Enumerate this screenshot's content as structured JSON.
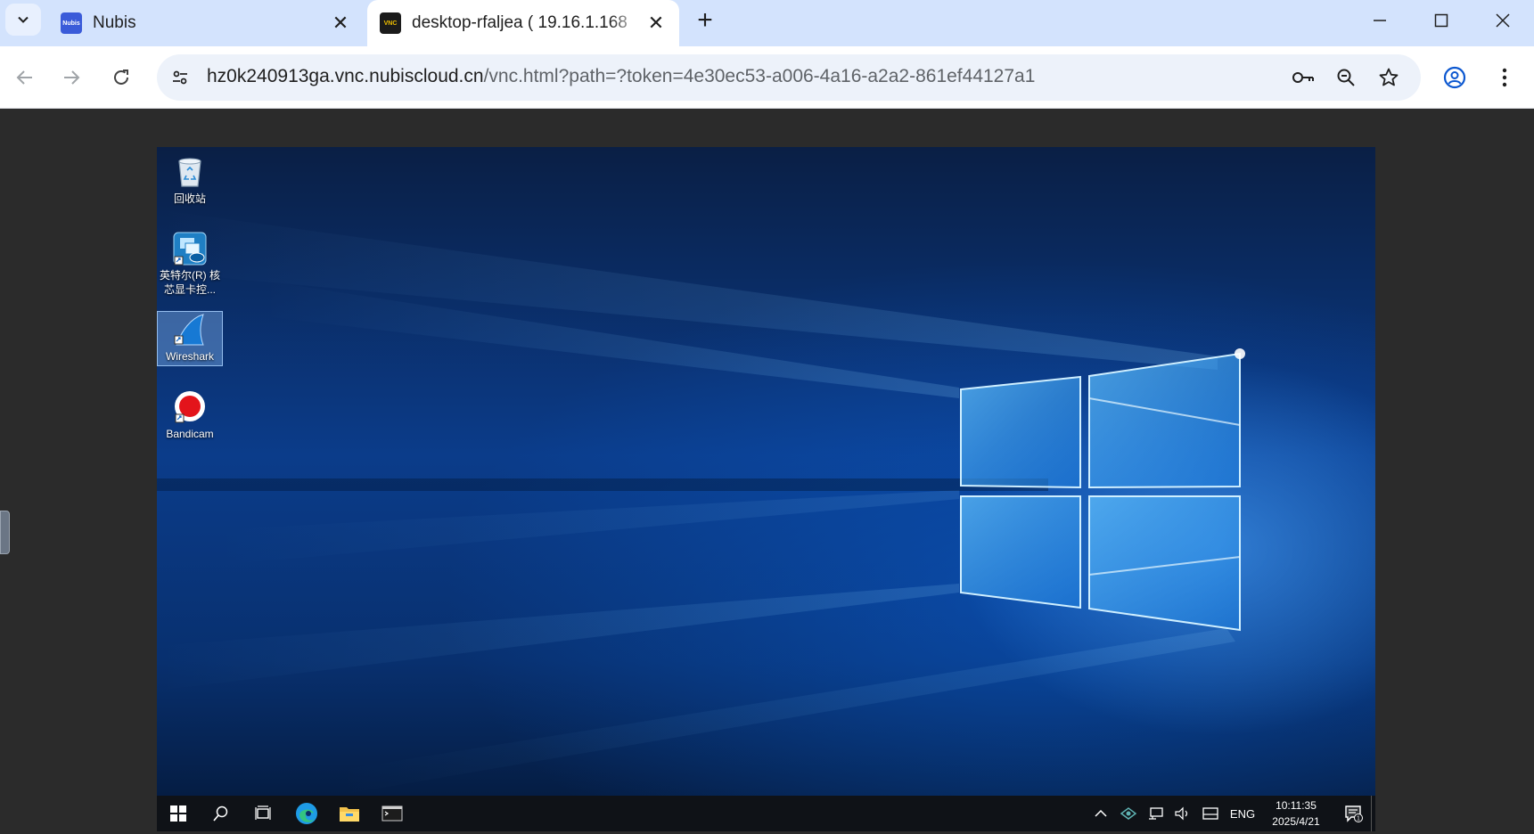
{
  "browser": {
    "tabs": [
      {
        "title": "Nubis",
        "favicon": "nubis-logo-icon",
        "favicon_text": "Nubis"
      },
      {
        "title": "desktop-rfaljea ( 19.16.1.168",
        "favicon": "vnc-icon",
        "favicon_text": "VNC"
      }
    ],
    "address": {
      "host": "hz0k240913ga.vnc.nubiscloud.cn",
      "path": "/vnc.html?path=?token=4e30ec53-a006-4a16-a2a2-861ef44127a1"
    },
    "colors": {
      "tabstrip": "#d3e3fd",
      "omnibox": "#edf2fa",
      "accent": "#0b57d0"
    }
  },
  "remote_desktop": {
    "icons": [
      {
        "label": "回收站",
        "icon": "recycle-bin-icon",
        "selected": false
      },
      {
        "label": "英特尔(R) 核芯显卡控...",
        "icon": "intel-graphics-icon",
        "selected": false
      },
      {
        "label": "Wireshark",
        "icon": "wireshark-icon",
        "selected": true
      },
      {
        "label": "Bandicam",
        "icon": "bandicam-icon",
        "selected": false
      }
    ],
    "taskbar": {
      "apps": [
        "start-icon",
        "search-icon",
        "task-view-icon",
        "edge-icon",
        "file-explorer-icon",
        "terminal-icon"
      ],
      "tray": {
        "language": "ENG",
        "time": "10:11:35",
        "date": "2025/4/21",
        "notification_count": "1"
      }
    }
  }
}
